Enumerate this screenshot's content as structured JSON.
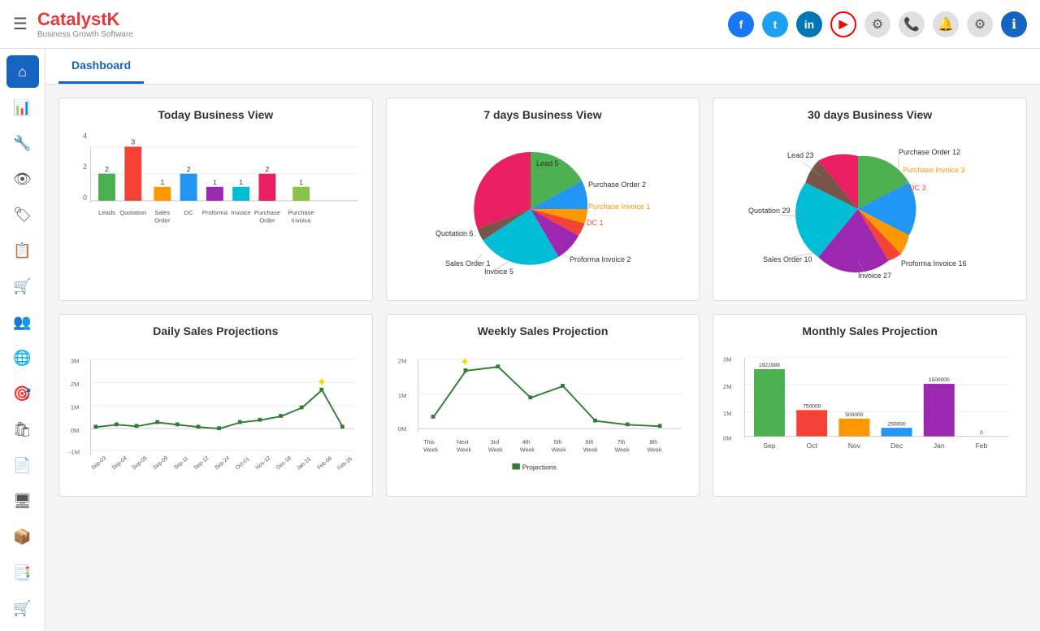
{
  "header": {
    "menu_icon": "☰",
    "logo": "CatalystK",
    "logo_sub": "Business Growth Software",
    "social": [
      {
        "label": "Facebook",
        "class": "fb",
        "icon": "f"
      },
      {
        "label": "Twitter",
        "class": "tw",
        "icon": "t"
      },
      {
        "label": "LinkedIn",
        "class": "li",
        "icon": "in"
      },
      {
        "label": "YouTube",
        "class": "yt",
        "icon": "▶"
      }
    ],
    "tools": [
      "⚙",
      "📞",
      "🔔",
      "⚙",
      "ℹ"
    ]
  },
  "sidebar": {
    "items": [
      {
        "icon": "⌂",
        "label": "home",
        "active": true
      },
      {
        "icon": "📊",
        "label": "dashboard"
      },
      {
        "icon": "🔧",
        "label": "tools"
      },
      {
        "icon": "👁",
        "label": "view"
      },
      {
        "icon": "🏷",
        "label": "tags"
      },
      {
        "icon": "📋",
        "label": "orders"
      },
      {
        "icon": "🛒",
        "label": "cart"
      },
      {
        "icon": "👥",
        "label": "users"
      },
      {
        "icon": "🌐",
        "label": "globe"
      },
      {
        "icon": "🎯",
        "label": "target"
      },
      {
        "icon": "🛍",
        "label": "shop"
      },
      {
        "icon": "📄",
        "label": "reports"
      },
      {
        "icon": "🖥",
        "label": "monitor"
      },
      {
        "icon": "📦",
        "label": "box"
      },
      {
        "icon": "📑",
        "label": "document"
      },
      {
        "icon": "🛒",
        "label": "purchase"
      }
    ]
  },
  "tabs": [
    {
      "label": "Dashboard",
      "active": true
    }
  ],
  "today_chart": {
    "title": "Today Business View",
    "y_labels": [
      "4",
      "2",
      "0"
    ],
    "bars": [
      {
        "label": "Leads",
        "value": 2,
        "color": "#4caf50",
        "height_pct": 50
      },
      {
        "label": "Quotation",
        "value": 3,
        "color": "#f44336",
        "height_pct": 75
      },
      {
        "label": "Sales Order",
        "value": 1,
        "color": "#ff9800",
        "height_pct": 25
      },
      {
        "label": "DC",
        "value": 2,
        "color": "#2196f3",
        "height_pct": 50
      },
      {
        "label": "Proforma",
        "value": 1,
        "color": "#9c27b0",
        "height_pct": 25
      },
      {
        "label": "Invoice",
        "value": 1,
        "color": "#00bcd4",
        "height_pct": 25
      },
      {
        "label": "Purchase Order",
        "value": 2,
        "color": "#e91e63",
        "height_pct": 50
      },
      {
        "label": "Purchase Invoice",
        "value": 1,
        "color": "#8bc34a",
        "height_pct": 25
      }
    ]
  },
  "seven_days_chart": {
    "title": "7 days Business View",
    "segments": [
      {
        "label": "Lead 5",
        "value": 5,
        "color": "#4caf50",
        "startAngle": 0,
        "endAngle": 65
      },
      {
        "label": "Purchase Order 2",
        "value": 2,
        "color": "#2196f3",
        "startAngle": 65,
        "endAngle": 92
      },
      {
        "label": "Purchase Invoice 1",
        "value": 1,
        "color": "#ff9800",
        "startAngle": 92,
        "endAngle": 106
      },
      {
        "label": "DC 1",
        "value": 1,
        "color": "#f44336",
        "startAngle": 106,
        "endAngle": 120
      },
      {
        "label": "Proforma Invoice 2",
        "value": 2,
        "color": "#9c27b0",
        "startAngle": 120,
        "endAngle": 147
      },
      {
        "label": "Invoice 5",
        "value": 5,
        "color": "#00bcd4",
        "startAngle": 147,
        "endAngle": 213
      },
      {
        "label": "Sales Order 1",
        "value": 1,
        "color": "#795548",
        "startAngle": 213,
        "endAngle": 227
      },
      {
        "label": "Quotation 6",
        "value": 6,
        "color": "#e91e63",
        "startAngle": 227,
        "endAngle": 360
      }
    ]
  },
  "thirty_days_chart": {
    "title": "30 days Business View",
    "segments": [
      {
        "label": "Lead 23",
        "value": 23,
        "color": "#4caf50",
        "startAngle": 0,
        "endAngle": 75
      },
      {
        "label": "Purchase Order 12",
        "value": 12,
        "color": "#2196f3",
        "startAngle": 75,
        "endAngle": 115
      },
      {
        "label": "Purchase Invoice 3",
        "value": 3,
        "color": "#ff9800",
        "startAngle": 115,
        "endAngle": 125
      },
      {
        "label": "DC 3",
        "value": 3,
        "color": "#f44336",
        "startAngle": 125,
        "endAngle": 135
      },
      {
        "label": "Proforma Invoice 16",
        "value": 16,
        "color": "#9c27b0",
        "startAngle": 135,
        "endAngle": 188
      },
      {
        "label": "Invoice 27",
        "value": 27,
        "color": "#00bcd4",
        "startAngle": 188,
        "endAngle": 276
      },
      {
        "label": "Sales Order 10",
        "value": 10,
        "color": "#795548",
        "startAngle": 276,
        "endAngle": 309
      },
      {
        "label": "Quotation 29",
        "value": 29,
        "color": "#e91e63",
        "startAngle": 309,
        "endAngle": 360
      }
    ]
  },
  "daily_projection": {
    "title": "Daily Sales Projections",
    "x_labels": [
      "Sep-03",
      "Sep-04",
      "Sep-05",
      "Sep-09",
      "Sep-11",
      "Sep-12",
      "Sep-24",
      "Oct-01",
      "Nov-12",
      "Dec-18",
      "Jan-15",
      "Feb-06",
      "Feb-26"
    ],
    "y_labels": [
      "3M",
      "2M",
      "1M",
      "0M",
      "-1M"
    ],
    "points": [
      15,
      12,
      14,
      20,
      12,
      10,
      8,
      25,
      30,
      40,
      65,
      95,
      15
    ]
  },
  "weekly_projection": {
    "title": "Weekly Sales Projection",
    "x_labels": [
      "This Week",
      "Next Week",
      "3rd Week",
      "4th Week",
      "5th Week",
      "6th Week",
      "7th Week",
      "8th Week"
    ],
    "y_labels": [
      "2M",
      "1M",
      "0M"
    ],
    "points": [
      20,
      85,
      90,
      40,
      65,
      15,
      12,
      8
    ]
  },
  "monthly_projection": {
    "title": "Monthly Sales Projection",
    "x_labels": [
      "Sep",
      "Oct",
      "Nov",
      "Dec",
      "Jan",
      "Feb"
    ],
    "y_labels": [
      "3M",
      "2M",
      "1M",
      "0M"
    ],
    "bars": [
      {
        "label": "Sep",
        "value": 1921989,
        "display": "1921989",
        "color": "#4caf50",
        "height_pct": 85
      },
      {
        "label": "Oct",
        "value": 750000,
        "display": "750000",
        "color": "#f44336",
        "height_pct": 33
      },
      {
        "label": "Nov",
        "value": 500000,
        "display": "500000",
        "color": "#ff9800",
        "height_pct": 22
      },
      {
        "label": "Dec",
        "value": 250000,
        "display": "250000",
        "color": "#2196f3",
        "height_pct": 11
      },
      {
        "label": "Jan",
        "value": 1500000,
        "display": "1500000",
        "color": "#9c27b0",
        "height_pct": 66
      },
      {
        "label": "Feb",
        "value": 0,
        "display": "0",
        "color": "#e91e63",
        "height_pct": 0
      }
    ]
  }
}
